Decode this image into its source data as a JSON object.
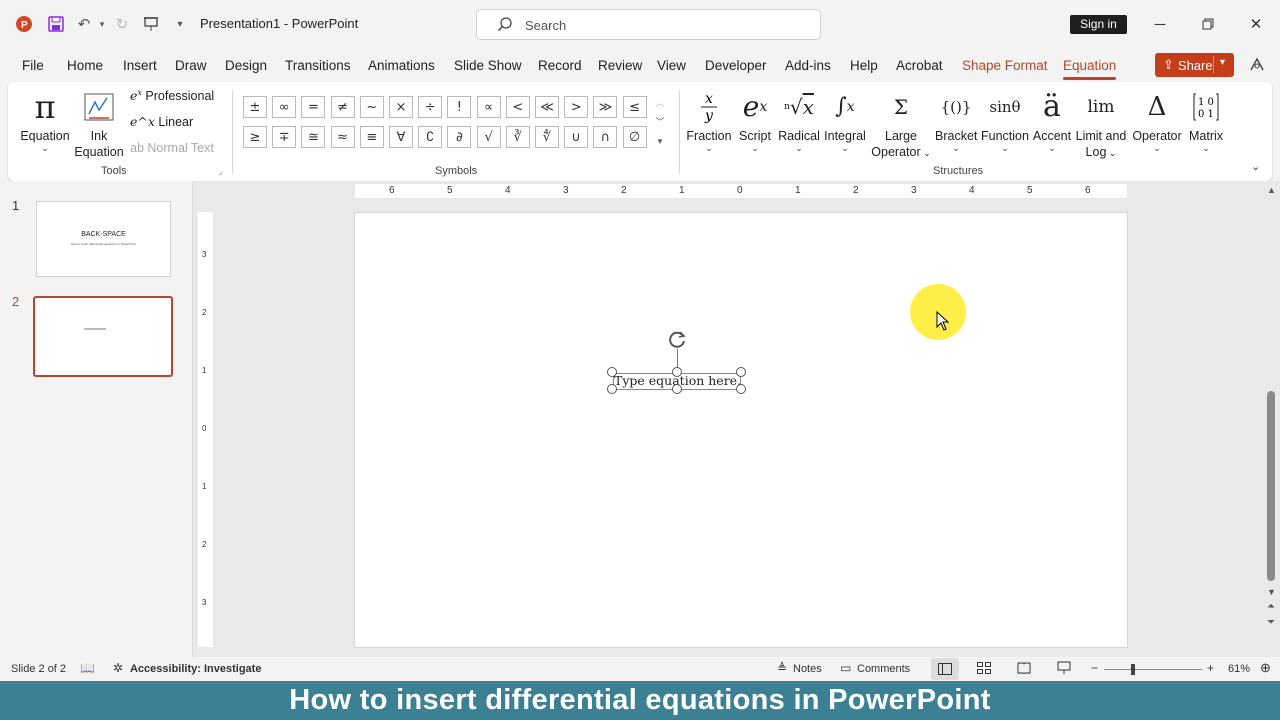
{
  "titlebar": {
    "doc_title": "Presentation1  -  PowerPoint",
    "search_placeholder": "Search",
    "signin": "Sign in"
  },
  "menu": {
    "tabs": [
      "File",
      "Home",
      "Insert",
      "Draw",
      "Design",
      "Transitions",
      "Animations",
      "Slide Show",
      "Record",
      "Review",
      "View",
      "Developer",
      "Add-ins",
      "Help",
      "Acrobat",
      "Shape Format",
      "Equation"
    ],
    "share": "Share"
  },
  "ribbon": {
    "tools": {
      "equation": "Equation",
      "ink": "Ink",
      "ink2": "Equation",
      "professional": "Professional",
      "linear": "Linear",
      "normal_text": "Normal Text",
      "group_label": "Tools"
    },
    "symbols": {
      "row1": [
        "±",
        "∞",
        "=",
        "≠",
        "~",
        "×",
        "÷",
        "!",
        "∝",
        "<",
        "≪",
        ">",
        "≫",
        "≤"
      ],
      "row2": [
        "≥",
        "∓",
        "≅",
        "≈",
        "≡",
        "∀",
        "∁",
        "∂",
        "√",
        "∛",
        "∜",
        "∪",
        "∩",
        "∅"
      ],
      "group_label": "Symbols"
    },
    "structures": {
      "items": [
        {
          "label": "Fraction",
          "label2": ""
        },
        {
          "label": "Script",
          "label2": ""
        },
        {
          "label": "Radical",
          "label2": ""
        },
        {
          "label": "Integral",
          "label2": ""
        },
        {
          "label": "Large",
          "label2": "Operator"
        },
        {
          "label": "Bracket",
          "label2": ""
        },
        {
          "label": "Function",
          "label2": ""
        },
        {
          "label": "Accent",
          "label2": ""
        },
        {
          "label": "Limit and",
          "label2": "Log"
        },
        {
          "label": "Operator",
          "label2": ""
        },
        {
          "label": "Matrix",
          "label2": ""
        }
      ],
      "group_label": "Structures"
    }
  },
  "slides": {
    "thumb1_title": "BACK-SPACE",
    "thumb1_sub": "How to insert differential equations in PowerPoint",
    "numbers": [
      "1",
      "2"
    ]
  },
  "rulers": {
    "h": [
      "6",
      "5",
      "4",
      "3",
      "2",
      "1",
      "0",
      "1",
      "2",
      "3",
      "4",
      "5",
      "6"
    ],
    "v": [
      "3",
      "2",
      "1",
      "0",
      "1",
      "2",
      "3"
    ]
  },
  "equation": {
    "placeholder": "Type equation here."
  },
  "status": {
    "slide": "Slide 2 of 2",
    "accessibility": "Accessibility: Investigate",
    "notes": "Notes",
    "comments": "Comments",
    "zoom": "61%"
  },
  "caption": "How to insert differential equations in PowerPoint"
}
